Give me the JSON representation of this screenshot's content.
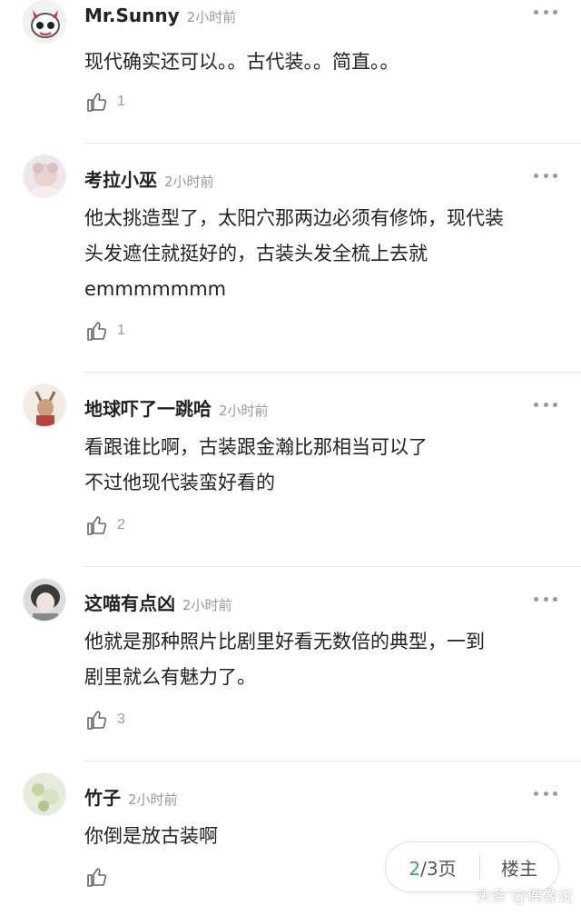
{
  "comments": [
    {
      "user": "Mr.Sunny",
      "time": "2小时前",
      "lines": [
        "现代确实还可以。。古代装。。简直。。"
      ],
      "likes": "1"
    },
    {
      "user": "考拉小巫",
      "time": "2小时前",
      "lines": [
        "他太挑造型了，太阳穴那两边必须有修饰，现代装",
        "头发遮住就挺好的，古装头发全梳上去就",
        "emmmmmmm"
      ],
      "likes": "1"
    },
    {
      "user": "地球吓了一跳哈",
      "time": "2小时前",
      "lines": [
        "看跟谁比啊，古装跟金瀚比那相当可以了",
        "不过他现代装蛮好看的"
      ],
      "likes": "2"
    },
    {
      "user": "这喵有点凶",
      "time": "2小时前",
      "lines": [
        "他就是那种照片比剧里好看无数倍的典型，一到",
        "剧里就么有魅力了。"
      ],
      "likes": "3"
    },
    {
      "user": "竹子",
      "time": "2小时前",
      "lines": [
        "你倒是放古装啊"
      ],
      "likes": ""
    }
  ],
  "pager": {
    "current": "2",
    "total_text": "/3页",
    "owner_label": "楼主"
  },
  "watermark": "头条 @偶像说",
  "icons": {
    "more": "more-dots-icon",
    "like": "thumbs-up-icon"
  },
  "colors": {
    "accent": "#36a86a",
    "muted": "#999999"
  }
}
